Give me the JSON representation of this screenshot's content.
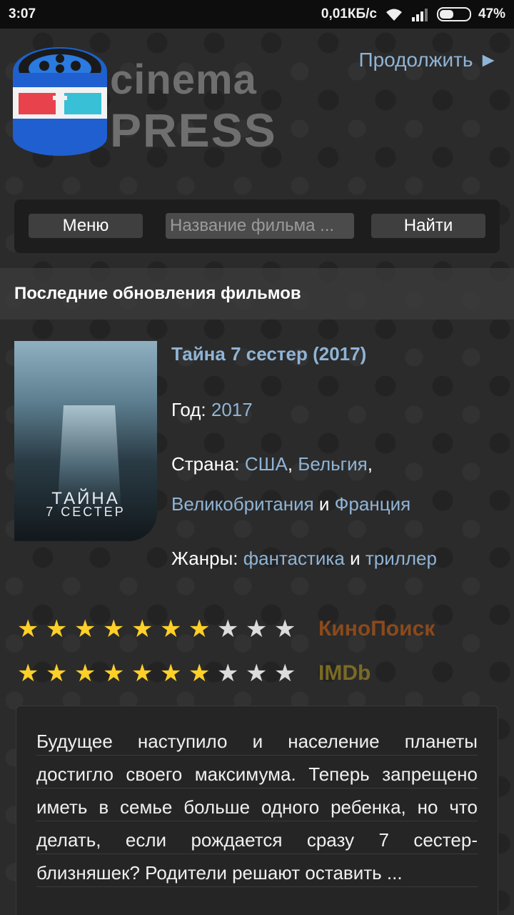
{
  "status_bar": {
    "time": "3:07",
    "network_speed": "0,01КБ/с",
    "battery": "47%",
    "battery_level": 0.47
  },
  "header": {
    "logo_line1": "cinema",
    "logo_line2": "PRESS",
    "continue_label": "Продолжить ►"
  },
  "search": {
    "menu_label": "Меню",
    "placeholder": "Название фильма ...",
    "find_label": "Найти"
  },
  "section": {
    "title": "Последние обновления фильмов"
  },
  "movie": {
    "title": "Тайна 7 сестер (2017)",
    "year_label": "Год: ",
    "year": "2017",
    "country_label": "Страна: ",
    "countries": [
      "США",
      "Бельгия",
      "Великобритания",
      "Франция"
    ],
    "sep_comma": ",",
    "sep_and": " и ",
    "genres_label": "Жанры: ",
    "genres": [
      "фантастика",
      "триллер"
    ],
    "poster_title_line1": "ТАЙНА",
    "poster_title_line2": "7 СЕСТЕР",
    "description": "Будущее наступило и население планеты достигло своего максимума. Теперь запрещено иметь в семье больше одного ребенка, но что делать, если рождается сразу 7 сестер-близняшек? Родители решают оставить ..."
  },
  "ratings": [
    {
      "source": "КиноПоиск",
      "filled": 7,
      "total": 10,
      "color": "#8a4a1c"
    },
    {
      "source": "IMDb",
      "filled": 7,
      "total": 10,
      "color": "#7a6a24"
    }
  ],
  "colors": {
    "link": "#8fb4d6",
    "star_on": "#ffd028",
    "star_off": "#dcdcdc"
  }
}
